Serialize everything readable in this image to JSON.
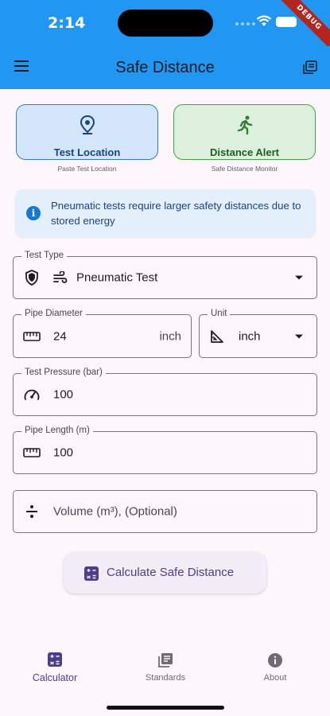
{
  "status_bar": {
    "time": "2:14",
    "debug_banner": "DEBUG"
  },
  "app_bar": {
    "title": "Safe Distance"
  },
  "cards": {
    "test_location": {
      "title": "Test Location",
      "subtitle": "Paste Test Location"
    },
    "distance_alert": {
      "title": "Distance Alert",
      "subtitle": "Safe Distance Monitor"
    }
  },
  "info_banner": {
    "text": "Pneumatic tests require larger safety distances due to stored energy"
  },
  "form": {
    "test_type": {
      "label": "Test Type",
      "value": "Pneumatic Test"
    },
    "pipe_diameter": {
      "label": "Pipe Diameter",
      "value": "24",
      "suffix": "inch"
    },
    "unit": {
      "label": "Unit",
      "value": "inch"
    },
    "test_pressure": {
      "label": "Test Pressure (bar)",
      "value": "100"
    },
    "pipe_length": {
      "label": "Pipe Length (m)",
      "value": "100"
    },
    "volume": {
      "placeholder": "Volume (m³), (Optional)"
    }
  },
  "calculate_button": {
    "label": "Calculate Safe Distance"
  },
  "bottom_nav": {
    "items": [
      {
        "label": "Calculator",
        "icon": "calculator-icon",
        "active": true
      },
      {
        "label": "Standards",
        "icon": "library-books-icon",
        "active": false
      },
      {
        "label": "About",
        "icon": "info-icon",
        "active": false
      }
    ]
  },
  "colors": {
    "primary": "#2196f3",
    "accent_purple": "#4a3f8f",
    "location_card": "#d4e6fb",
    "alert_card": "#ddf0de",
    "alert_green": "#2e7d32"
  }
}
